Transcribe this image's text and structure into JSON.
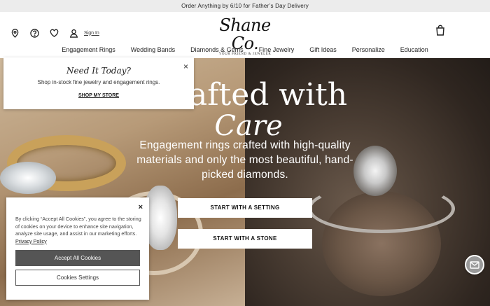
{
  "announcement": "Order Anything by 6/10 for Father’s Day Delivery",
  "header": {
    "sign_in": "Sign In",
    "logo_name": "Shane Co.",
    "logo_tagline": "YOUR FRIEND & JEWELER",
    "icons": [
      "location-icon",
      "help-icon",
      "heart-icon",
      "user-icon",
      "shopping-bag-icon"
    ]
  },
  "nav": {
    "items": [
      "Engagement Rings",
      "Wedding Bands",
      "Diamonds & Gems",
      "Fine Jewelry",
      "Gift Ideas",
      "Personalize",
      "Education"
    ]
  },
  "hero": {
    "headline_line1": "afted with",
    "headline_line2": "Care",
    "subcopy": "Engagement rings crafted with high-quality materials and only the most beautiful, hand-picked diamonds.",
    "cta_setting": "START WITH A SETTING",
    "cta_stone": "START WITH A STONE"
  },
  "store_popup": {
    "title": "Need It Today?",
    "description": "Shop in-stock fine jewelry and engagement rings.",
    "link": "SHOP MY STORE",
    "close": "×"
  },
  "cookie_banner": {
    "close": "×",
    "text": "By clicking “Accept All Cookies”, you agree to the storing of cookies on your device to enhance site navigation, analyze site usage, and assist in our marketing efforts.",
    "privacy_link": "Privacy Policy",
    "accept_label": "Accept All Cookies",
    "settings_label": "Cookies Settings"
  }
}
